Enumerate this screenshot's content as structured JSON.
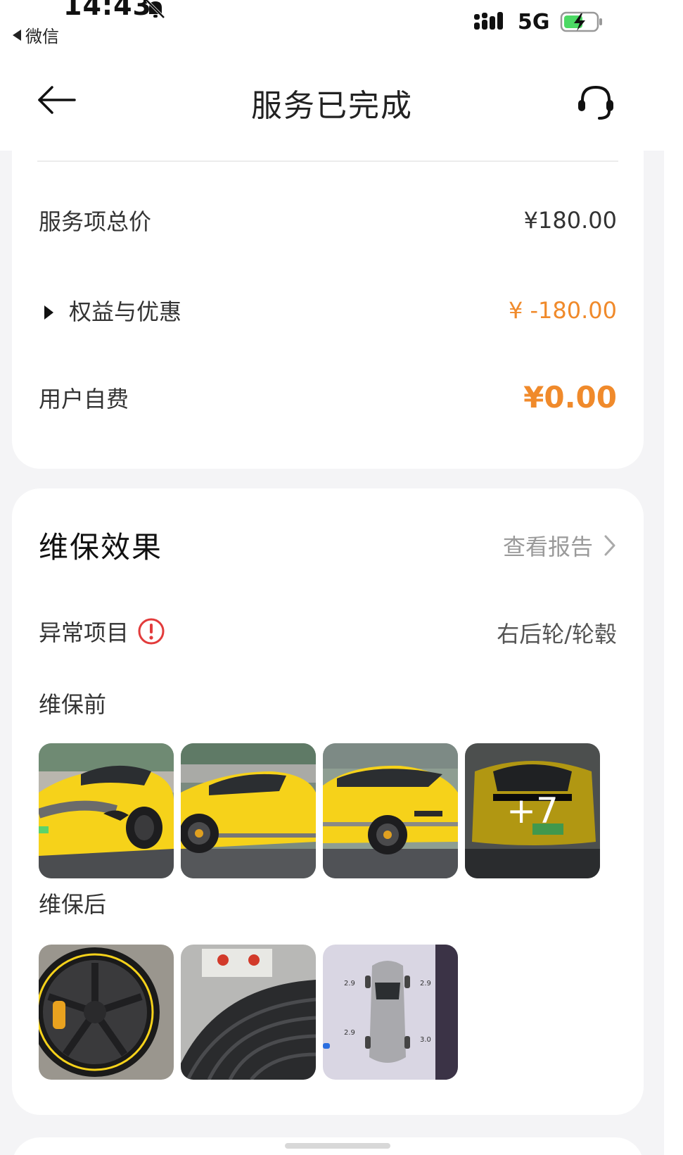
{
  "status_bar": {
    "time": "14:43",
    "back_app": "微信",
    "network": "5G"
  },
  "nav": {
    "title": "服务已完成"
  },
  "price": {
    "total_label": "服务项总价",
    "total_value": "¥180.00",
    "benefit_label": "权益与优惠",
    "benefit_value": "¥ -180.00",
    "self_pay_label": "用户自费",
    "self_pay_value": "¥0.00"
  },
  "effect": {
    "title": "维保效果",
    "report_link": "查看报告",
    "abnormal_label": "异常项目",
    "abnormal_value": "右后轮/轮毂",
    "before_label": "维保前",
    "after_label": "维保后",
    "more_count": "+7"
  },
  "photo_readouts": {
    "pressure_front_left": "2.9",
    "pressure_front_right": "2.9",
    "pressure_rear_left": "2.9",
    "pressure_rear_right": "3.0"
  },
  "colors": {
    "accent_orange": "#f08a2b",
    "warning_red": "#e23b3b",
    "car_yellow": "#f6d21a"
  }
}
